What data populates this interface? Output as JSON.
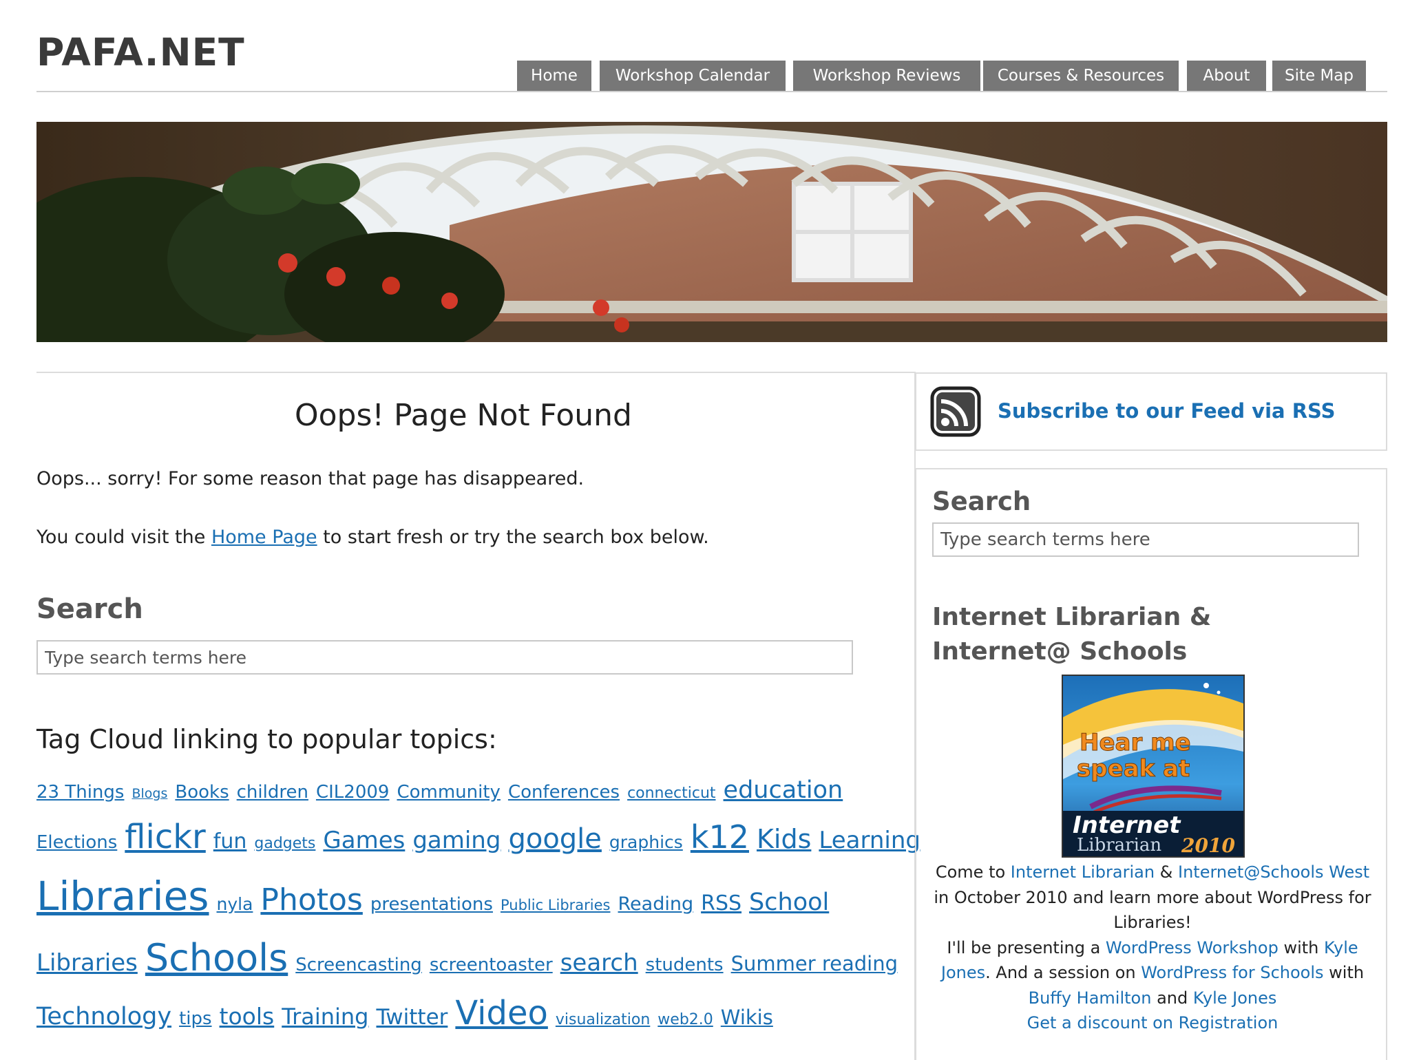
{
  "site": {
    "title": "PAFA.NET"
  },
  "nav": {
    "items": [
      {
        "label": "Home"
      },
      {
        "label": "Workshop Calendar"
      },
      {
        "label": "Workshop Reviews"
      },
      {
        "label": "Courses & Resources"
      },
      {
        "label": "About"
      },
      {
        "label": "Site Map"
      }
    ]
  },
  "main": {
    "heading": "Oops! Page Not Found",
    "p1": "Oops... sorry! For some reason that page has disappeared.",
    "p2_before": "You could visit the ",
    "p2_link": "Home Page",
    "p2_after": " to start fresh or try the search box below.",
    "search_title": "Search",
    "search_placeholder": "Type search terms here",
    "tag_heading": "Tag Cloud linking to popular topics:",
    "tags": [
      "23 Things",
      "Blogs",
      "Books",
      "children",
      "CIL2009",
      "Community",
      "Conferences",
      "connecticut",
      "education",
      "Elections",
      "flickr",
      "fun",
      "gadgets",
      "Games",
      "gaming",
      "google",
      "graphics",
      "k12",
      "Kids",
      "Learning",
      "Libraries",
      "nyla",
      "Photos",
      "presentations",
      "Public Libraries",
      "Reading",
      "RSS",
      "School",
      "Libraries",
      "Schools",
      "Screencasting",
      "screentoaster",
      "search",
      "students",
      "Summer reading",
      "Technology",
      "tips",
      "tools",
      "Training",
      "Twitter",
      "Video",
      "visualization",
      "web2.0",
      "Wikis"
    ]
  },
  "sidebar": {
    "rss_label": "Subscribe to our Feed via RSS",
    "search_title": "Search",
    "search_placeholder": "Type search terms here",
    "il_heading": "Internet Librarian & Internet@ Schools",
    "promo_line1": "Hear me",
    "promo_line2": "speak at",
    "promo_line3": "Internet",
    "promo_line4": "Librarian",
    "promo_year": "2010",
    "promo": {
      "t1": "Come to ",
      "l1": "Internet Librarian",
      "t2": " & ",
      "l2": "Internet@Schools West",
      "t3": "in October 2010 and learn more about WordPress for Libraries!",
      "t4": "I'll be presenting a ",
      "l3": "WordPress Workshop",
      "t5": " with ",
      "l4": "Kyle Jones",
      "t6": ". And a session on ",
      "l5": "WordPress for Schools",
      "t7": " with ",
      "l6": "Buffy Hamilton",
      "t8": " and ",
      "l7": "Kyle Jones",
      "l8": "Get a discount on Registration"
    }
  }
}
